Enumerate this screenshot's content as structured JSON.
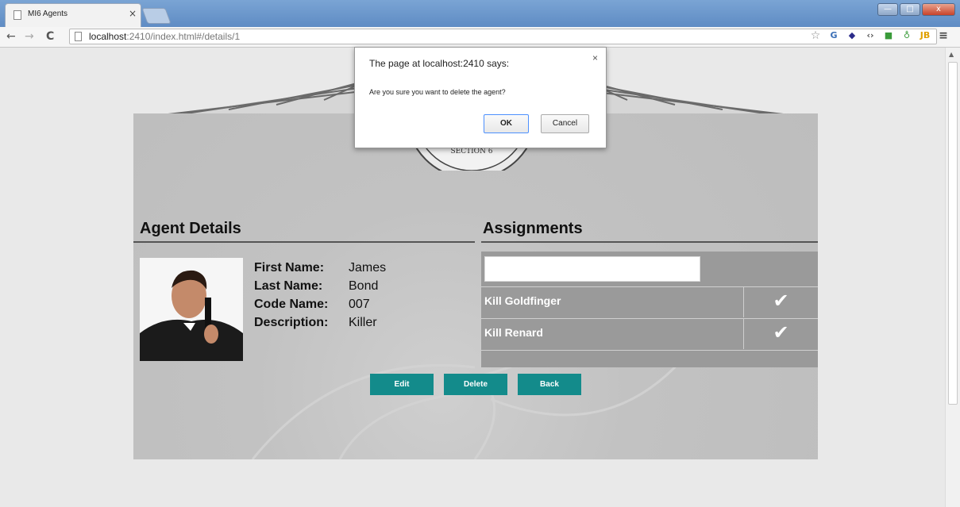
{
  "browser": {
    "tab_title": "MI6 Agents",
    "tab_close": "×",
    "url_host": "localhost",
    "url_rest": ":2410/index.html#/details/1",
    "nav_back": "←",
    "nav_forward": "→",
    "nav_reload": "C",
    "star": "☆",
    "extensions": [
      "G",
      "◆",
      "‹›",
      "■",
      "♁",
      "JB",
      "≡"
    ],
    "window_controls": [
      "—",
      "□",
      "x"
    ]
  },
  "banner": {
    "seal_text": "SECTION 6"
  },
  "agent_details": {
    "title": "Agent Details",
    "fields": [
      {
        "label": "First Name:",
        "value": "James"
      },
      {
        "label": "Last Name:",
        "value": "Bond"
      },
      {
        "label": "Code Name:",
        "value": "007"
      },
      {
        "label": "Description:",
        "value": "Killer"
      }
    ]
  },
  "assignments": {
    "title": "Assignments",
    "input_value": "",
    "items": [
      {
        "label": "Kill Goldfinger",
        "check": "✔"
      },
      {
        "label": "Kill Renard",
        "check": "✔"
      }
    ]
  },
  "actions": {
    "edit": "Edit",
    "delete": "Delete",
    "back": "Back"
  },
  "dialog": {
    "title": "The page at localhost:2410 says:",
    "message": "Are you sure you want to delete the agent?",
    "ok": "OK",
    "cancel": "Cancel",
    "close": "×"
  },
  "colors": {
    "button_teal": "#138b8b",
    "panel_gray": "#9a9a9a",
    "content_gray": "#c2c2c2"
  }
}
